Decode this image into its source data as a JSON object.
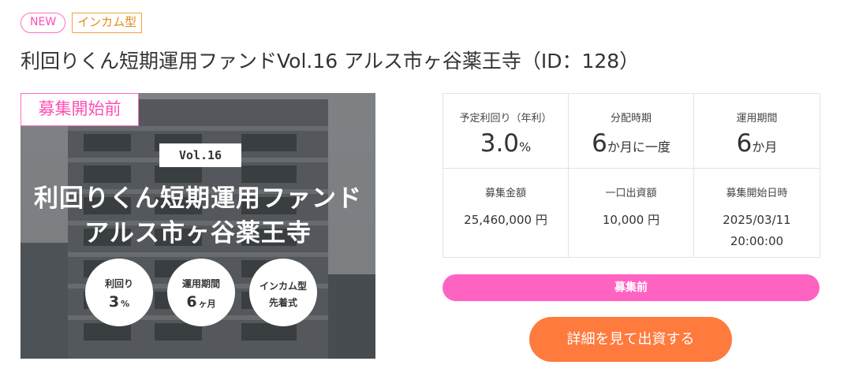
{
  "badges": {
    "new": "NEW",
    "type": "インカム型"
  },
  "title": "利回りくん短期運用ファンドVol.16 アルス市ヶ谷薬王寺（ID：128）",
  "hero": {
    "status": "募集開始前",
    "vol": "Vol.16",
    "line1": "利回りくん短期運用ファンド",
    "line2": "アルス市ヶ谷薬王寺",
    "circles": [
      {
        "label": "利回り",
        "value": "3",
        "unit": "%"
      },
      {
        "label": "運用期間",
        "value": "6",
        "unit": "ヶ月"
      },
      {
        "label": "インカム型",
        "sub": "先着式"
      }
    ]
  },
  "info": {
    "yield_label": "予定利回り（年利）",
    "yield_value": "3.0",
    "yield_unit": "%",
    "dist_label": "分配時期",
    "dist_value": "6",
    "dist_unit": "か月に一度",
    "term_label": "運用期間",
    "term_value": "6",
    "term_unit": "か月",
    "amount_label": "募集金額",
    "amount_value": "25,460,000 円",
    "unit_label": "一口出資額",
    "unit_value": "10,000 円",
    "start_label": "募集開始日時",
    "start_date": "2025/03/11",
    "start_time": "20:00:00"
  },
  "status_bar": "募集前",
  "detail_button": "詳細を見て出資する",
  "colors": {
    "pink": "#ff63c2",
    "orange": "#ff7a3d",
    "income_badge": "#f2a23a"
  }
}
